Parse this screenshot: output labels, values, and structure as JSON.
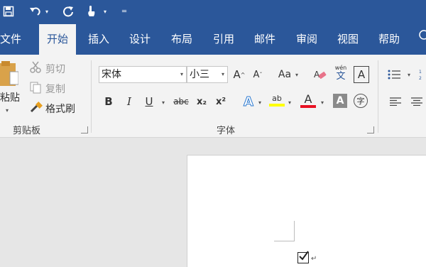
{
  "quick_access": {
    "save_icon": "save-icon",
    "undo_icon": "undo-icon",
    "redo_icon": "redo-icon",
    "touch_icon": "touch-mode-icon",
    "customize_icon": "customize-qat-icon"
  },
  "tabs": [
    {
      "label": "文件"
    },
    {
      "label": "开始"
    },
    {
      "label": "插入"
    },
    {
      "label": "设计"
    },
    {
      "label": "布局"
    },
    {
      "label": "引用"
    },
    {
      "label": "邮件"
    },
    {
      "label": "审阅"
    },
    {
      "label": "视图"
    },
    {
      "label": "帮助"
    }
  ],
  "clipboard": {
    "paste_label": "粘贴",
    "cut_label": "剪切",
    "copy_label": "复制",
    "format_painter_label": "格式刷",
    "group_label": "剪贴板"
  },
  "font": {
    "font_name": "宋体",
    "font_size": "小三",
    "grow_label": "A",
    "shrink_label": "A",
    "change_case_label": "Aa",
    "phonetic_top": "wén",
    "phonetic_bottom": "文",
    "border_label": "A",
    "bold_label": "B",
    "italic_label": "I",
    "underline_label": "U",
    "strike_label": "abc",
    "subscript_label": "x₂",
    "superscript_label": "x²",
    "effects_label": "A",
    "highlight_label": "ab",
    "font_color_label": "A",
    "shading_label": "A",
    "enclose_label": "字",
    "group_label": "字体",
    "font_color": "#e81123",
    "highlight_color": "#ffff00"
  },
  "document": {
    "paragraph_mark": "↵"
  },
  "colors": {
    "brand": "#2b579a",
    "ribbon": "#f3f3f3"
  }
}
